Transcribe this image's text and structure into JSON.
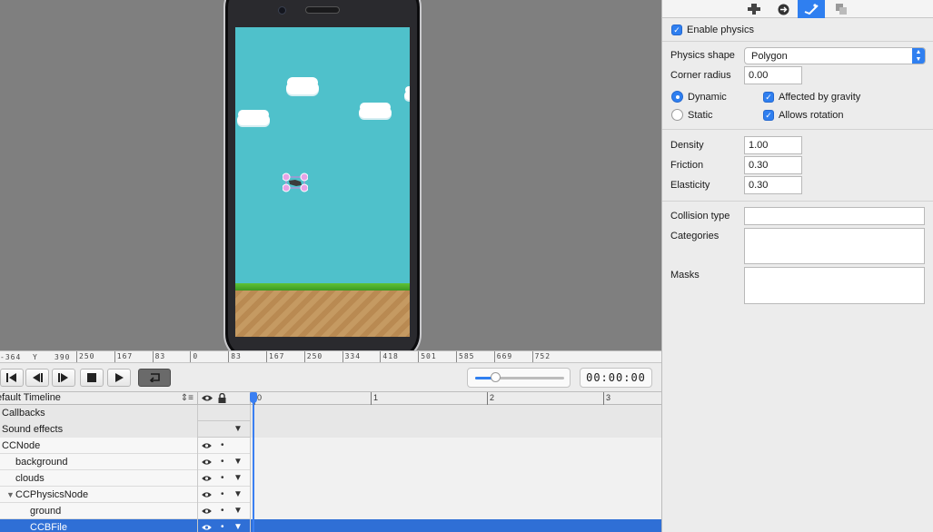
{
  "canvas": {
    "ruler": {
      "x_value": "-364",
      "y_label": "Y",
      "y_value": "390",
      "ticks": [
        "250",
        "167",
        "83",
        "0",
        "83",
        "167",
        "250",
        "334",
        "418",
        "501",
        "585",
        "669",
        "752"
      ]
    }
  },
  "transport": {
    "buttons": {
      "rewind": "rewind-icon",
      "step_back": "step-back-icon",
      "step_forward": "step-forward-icon",
      "stop": "stop-icon",
      "play": "play-icon",
      "loop": "loop-icon"
    },
    "scrub_level": 0.22,
    "timecode": "00:00:00"
  },
  "timeline": {
    "name": "efault Timeline",
    "sort_icon": "⇕≡",
    "col_icons": {
      "visible": "eye-icon",
      "lock": "lock-icon"
    },
    "ruler_ticks": [
      "0",
      "1",
      "2",
      "3"
    ],
    "rows": [
      {
        "label": "Callbacks",
        "category": true
      },
      {
        "label": "Sound effects",
        "category": true
      },
      {
        "label": "CCNode"
      },
      {
        "label": "background"
      },
      {
        "label": "clouds"
      },
      {
        "label": "CCPhysicsNode"
      },
      {
        "label": "ground"
      },
      {
        "label": "CCBFile",
        "selected": true
      }
    ]
  },
  "inspector": {
    "tabs": [
      "properties-icon",
      "code-connections-icon",
      "physics-icon",
      "templates-icon"
    ],
    "active_tab": 2,
    "enable_physics": "Enable physics",
    "physics_shape_label": "Physics shape",
    "physics_shape_value": "Polygon",
    "corner_radius_label": "Corner radius",
    "corner_radius_value": "0.00",
    "dynamic_label": "Dynamic",
    "static_label": "Static",
    "affected_gravity_label": "Affected by gravity",
    "allows_rotation_label": "Allows rotation",
    "density_label": "Density",
    "density_value": "1.00",
    "friction_label": "Friction",
    "friction_value": "0.30",
    "elasticity_label": "Elasticity",
    "elasticity_value": "0.30",
    "collision_type_label": "Collision type",
    "collision_type_value": "",
    "categories_label": "Categories",
    "categories_value": "",
    "masks_label": "Masks",
    "masks_value": ""
  },
  "colors": {
    "accent": "#2f7ff0",
    "sky": "#4fc1cb",
    "selection": "#2f6fd6"
  }
}
